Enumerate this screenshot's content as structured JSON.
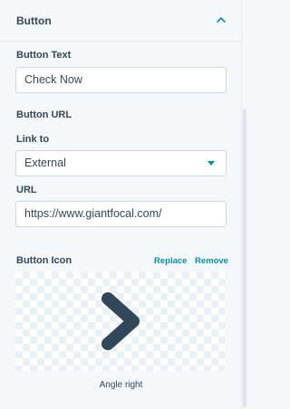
{
  "section": {
    "title": "Button"
  },
  "button_text": {
    "label": "Button Text",
    "value": "Check Now"
  },
  "button_url": {
    "heading": "Button URL",
    "link_to_label": "Link to",
    "link_to_value": "External",
    "url_label": "URL",
    "url_value": "https://www.giantfocal.com/"
  },
  "button_icon": {
    "label": "Button Icon",
    "replace_label": "Replace",
    "remove_label": "Remove",
    "icon_name": "angle-right-icon",
    "caption": "Angle right"
  },
  "colors": {
    "accent": "#0091ae",
    "icon": "#33475b",
    "text": "#33475b",
    "border": "#cbd6e2"
  }
}
